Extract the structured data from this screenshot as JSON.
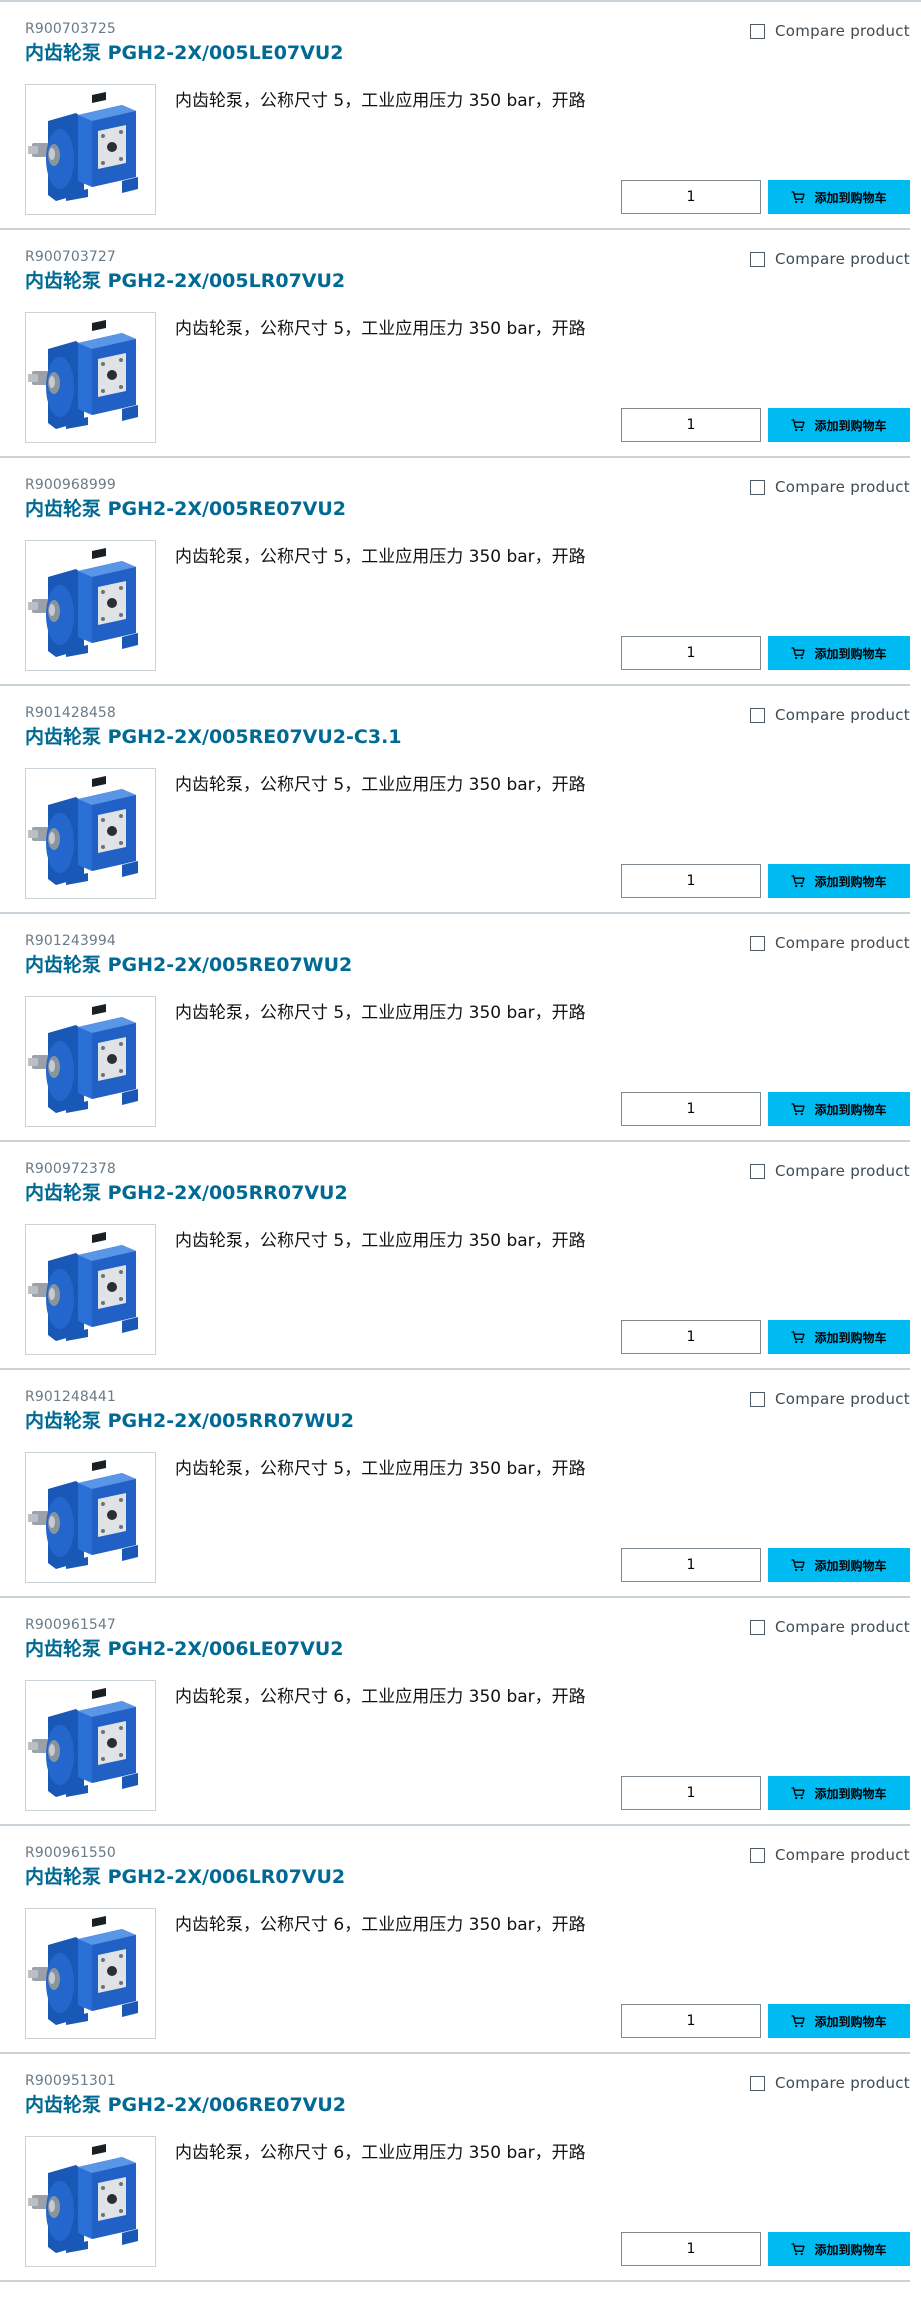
{
  "compare_label": "Compare product",
  "cart_label": "添加到购物车",
  "icons": {
    "cart": "shopping-cart-icon",
    "thumbnail": "gear-pump-image"
  },
  "colors": {
    "title": "#006a94",
    "cart_button": "#00baf2",
    "divider": "#c8d3da",
    "pump_blue": "#1e63c8"
  },
  "products": [
    {
      "sku": "R900703725",
      "title": "内齿轮泵 PGH2-2X/005LE07VU2",
      "description": "内齿轮泵，公称尺寸 5，工业应用压力 350 bar，开路",
      "quantity": "1"
    },
    {
      "sku": "R900703727",
      "title": "内齿轮泵 PGH2-2X/005LR07VU2",
      "description": "内齿轮泵，公称尺寸 5，工业应用压力 350 bar，开路",
      "quantity": "1"
    },
    {
      "sku": "R900968999",
      "title": "内齿轮泵 PGH2-2X/005RE07VU2",
      "description": "内齿轮泵，公称尺寸 5，工业应用压力 350 bar，开路",
      "quantity": "1"
    },
    {
      "sku": "R901428458",
      "title": "内齿轮泵 PGH2-2X/005RE07VU2-C3.1",
      "description": "内齿轮泵，公称尺寸 5，工业应用压力 350 bar，开路",
      "quantity": "1"
    },
    {
      "sku": "R901243994",
      "title": "内齿轮泵 PGH2-2X/005RE07WU2",
      "description": "内齿轮泵，公称尺寸 5，工业应用压力 350 bar，开路",
      "quantity": "1"
    },
    {
      "sku": "R900972378",
      "title": "内齿轮泵 PGH2-2X/005RR07VU2",
      "description": "内齿轮泵，公称尺寸 5，工业应用压力 350 bar，开路",
      "quantity": "1"
    },
    {
      "sku": "R901248441",
      "title": "内齿轮泵 PGH2-2X/005RR07WU2",
      "description": "内齿轮泵，公称尺寸 5，工业应用压力 350 bar，开路",
      "quantity": "1"
    },
    {
      "sku": "R900961547",
      "title": "内齿轮泵 PGH2-2X/006LE07VU2",
      "description": "内齿轮泵，公称尺寸 6，工业应用压力 350 bar，开路",
      "quantity": "1"
    },
    {
      "sku": "R900961550",
      "title": "内齿轮泵 PGH2-2X/006LR07VU2",
      "description": "内齿轮泵，公称尺寸 6，工业应用压力 350 bar，开路",
      "quantity": "1"
    },
    {
      "sku": "R900951301",
      "title": "内齿轮泵 PGH2-2X/006RE07VU2",
      "description": "内齿轮泵，公称尺寸 6，工业应用压力 350 bar，开路",
      "quantity": "1"
    }
  ]
}
